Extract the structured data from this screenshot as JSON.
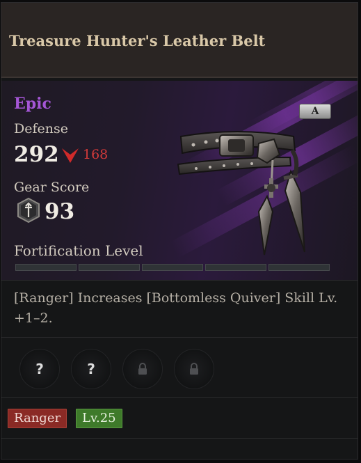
{
  "item": {
    "name": "Treasure Hunter's Leather Belt",
    "rarity": "Epic",
    "grade_badge": "A"
  },
  "stats": {
    "defense_label": "Defense",
    "defense_value": "292",
    "defense_change": "168",
    "gear_score_label": "Gear Score",
    "gear_score_value": "93",
    "fortification_label": "Fortification Level",
    "fortification_filled": 0,
    "fortification_segments": 5
  },
  "description": "[Ranger] Increases [Bottomless Quiver] Skill Lv. +1–2.",
  "sockets": [
    {
      "state": "unknown",
      "symbol": "?"
    },
    {
      "state": "unknown",
      "symbol": "?"
    },
    {
      "state": "locked",
      "icon": "lock-icon"
    },
    {
      "state": "locked",
      "icon": "lock-icon"
    }
  ],
  "tags": {
    "class": "Ranger",
    "level": "Lv.25"
  },
  "colors": {
    "rarity": "#a556d6",
    "decrease": "#d23a3a",
    "class_tag": "#8a2a25",
    "level_tag": "#3e7a2a"
  }
}
